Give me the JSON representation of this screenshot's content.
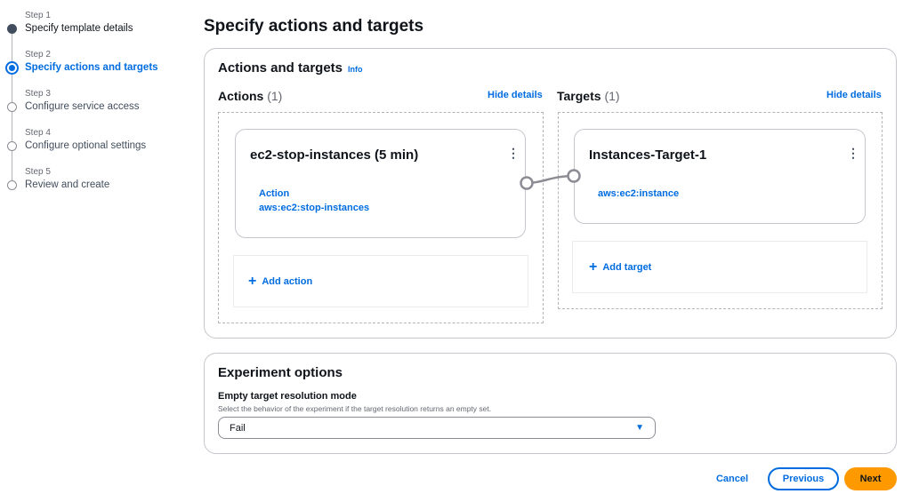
{
  "steps": [
    {
      "label": "Step 1",
      "name": "Specify template details",
      "state": "done"
    },
    {
      "label": "Step 2",
      "name": "Specify actions and targets",
      "state": "active"
    },
    {
      "label": "Step 3",
      "name": "Configure service access",
      "state": "pending"
    },
    {
      "label": "Step 4",
      "name": "Configure optional settings",
      "state": "pending"
    },
    {
      "label": "Step 5",
      "name": "Review and create",
      "state": "pending"
    }
  ],
  "page_title": "Specify actions and targets",
  "actions_targets": {
    "title": "Actions and targets",
    "info": "Info",
    "actions": {
      "title": "Actions",
      "count": "(1)",
      "hide": "Hide details",
      "card": {
        "title": "ec2-stop-instances (5 min)",
        "kind": "Action",
        "value": "aws:ec2:stop-instances"
      },
      "add": "Add action"
    },
    "targets": {
      "title": "Targets",
      "count": "(1)",
      "hide": "Hide details",
      "card": {
        "title": "Instances-Target-1",
        "value": "aws:ec2:instance"
      },
      "add": "Add target"
    }
  },
  "options": {
    "title": "Experiment options",
    "field_label": "Empty target resolution mode",
    "description": "Select the behavior of the experiment if the target resolution returns an empty set.",
    "value": "Fail"
  },
  "footer": {
    "cancel": "Cancel",
    "previous": "Previous",
    "next": "Next"
  },
  "colors": {
    "accent": "#006ce0",
    "primary": "#ff9900"
  }
}
